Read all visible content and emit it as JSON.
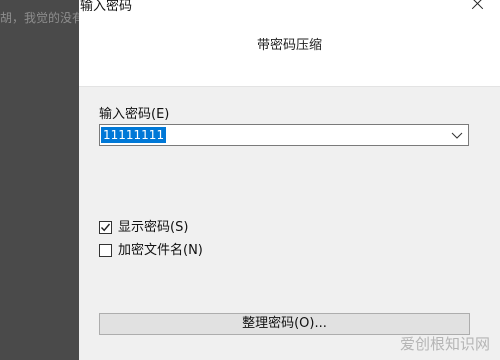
{
  "background_text": "胡，我觉的没有",
  "dialog": {
    "window_title": "输入密码",
    "header_title": "带密码压缩",
    "password_label": "输入密码(E)",
    "password_value": "11111111",
    "show_password_label": "显示密码(S)",
    "show_password_checked": true,
    "encrypt_filenames_label": "加密文件名(N)",
    "encrypt_filenames_checked": false,
    "organize_button_label": "整理密码(O)..."
  },
  "watermark": "爱创根知识网",
  "colors": {
    "selection": "#0078d7",
    "dialog_body": "#f0f0f0",
    "backdrop": "#4a4a4a"
  }
}
